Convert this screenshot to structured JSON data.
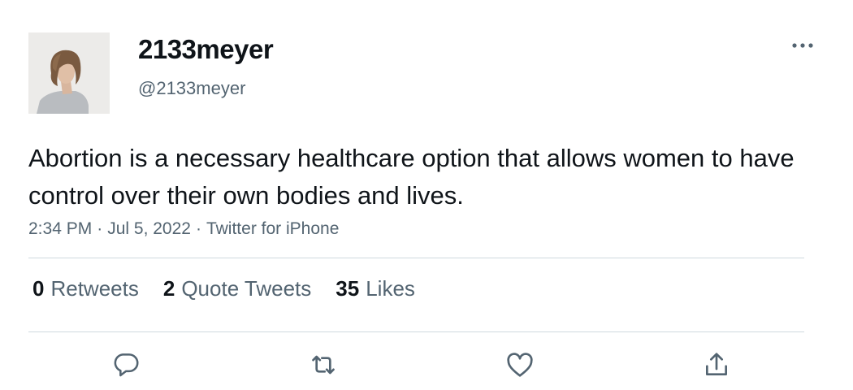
{
  "tweet": {
    "display_name": "2133meyer",
    "handle": "@2133meyer",
    "text": "Abortion is a necessary healthcare option that allows women to have control over their own bodies and lives.",
    "time": "2:34 PM",
    "date": "Jul 5, 2022",
    "source": "Twitter for iPhone",
    "separator": "·"
  },
  "stats": {
    "retweets": {
      "count": "0",
      "label": "Retweets"
    },
    "quote_tweets": {
      "count": "2",
      "label": "Quote Tweets"
    },
    "likes": {
      "count": "35",
      "label": "Likes"
    }
  },
  "icons": {
    "more": "more-horizontal-icon",
    "reply": "reply-icon",
    "retweet": "retweet-icon",
    "like": "heart-icon",
    "share": "share-icon"
  },
  "colors": {
    "primary_text": "#0f1419",
    "secondary_text": "#536471",
    "divider": "#cfd9de",
    "icon": "#536471"
  }
}
